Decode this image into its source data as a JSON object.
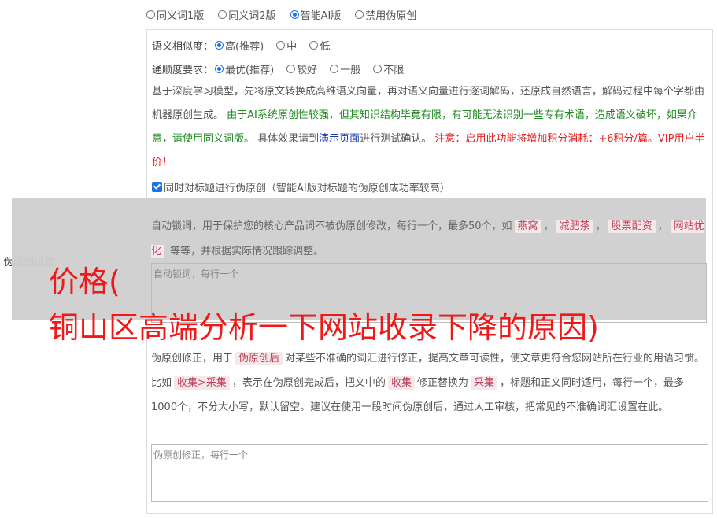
{
  "modes": [
    {
      "label": "同义词1版",
      "checked": false
    },
    {
      "label": "同义词2版",
      "checked": false
    },
    {
      "label": "智能AI版",
      "checked": true
    },
    {
      "label": "禁用伪原创",
      "checked": false
    }
  ],
  "left_label": "伪原创设置",
  "similarity": {
    "label": "语义相似度：",
    "options": [
      {
        "label": "高(推荐)",
        "checked": true
      },
      {
        "label": "中",
        "checked": false
      },
      {
        "label": "低",
        "checked": false
      }
    ]
  },
  "fluency": {
    "label": "通顺度要求：",
    "options": [
      {
        "label": "最优(推荐)",
        "checked": true
      },
      {
        "label": "较好",
        "checked": false
      },
      {
        "label": "一般",
        "checked": false
      },
      {
        "label": "不限",
        "checked": false
      }
    ]
  },
  "ai_desc": {
    "p1": "基于深度学习模型，先将原文转换成高维语义向量，再对语义向量进行逐词解码，还原成自然语言，解码过程中每个字都由机器原创生成。",
    "green": "由于AI系统原创性较强，但其知识结构毕竟有限，有可能无法识别一些专有术语，造成语义破坏，如果介意，请使用同义词版。",
    "p2": "具体效果请到",
    "link": "演示页面",
    "p3": "进行测试确认。",
    "red": "注意：启用此功能将增加积分消耗：+6积分/篇。VIP用户半价！"
  },
  "title_checkbox": "同时对标题进行伪原创（智能AI版对标题的伪原创成功率较高）",
  "lock": {
    "desc_a": "自动锁词，用于保护您的核心产品词不被伪原创修改，每行一个，最多50个，如",
    "tags": [
      "燕窝",
      "减肥茶",
      "股票配资",
      "网站优化"
    ],
    "desc_b": "等等，并根据实际情况跟踪调整。",
    "placeholder": "自动锁词，每行一个"
  },
  "fix": {
    "t1": "伪原创修正，用于",
    "tag1": "伪原创后",
    "t2": "对某些不准确的词汇进行修正，提高文章可读性，使文章更符合您网站所在行业的用语习惯。比如",
    "tag2": "收集>采集",
    "t3": "，表示在伪原创完成后，把文中的",
    "tag3": "收集",
    "t4": "修正替换为",
    "tag4": "采集",
    "t5": "，标题和正文同时适用，每行一个，最多1000个，不分大小写，默认留空。建议在使用一段时间伪原创后，通过人工审核，把常见的不准确词汇设置在此。",
    "placeholder": "伪原创修正，每行一个"
  },
  "overlay": {
    "line1": "价格(",
    "line2": "铜山区高端分析一下网站收录下降的原因)"
  }
}
